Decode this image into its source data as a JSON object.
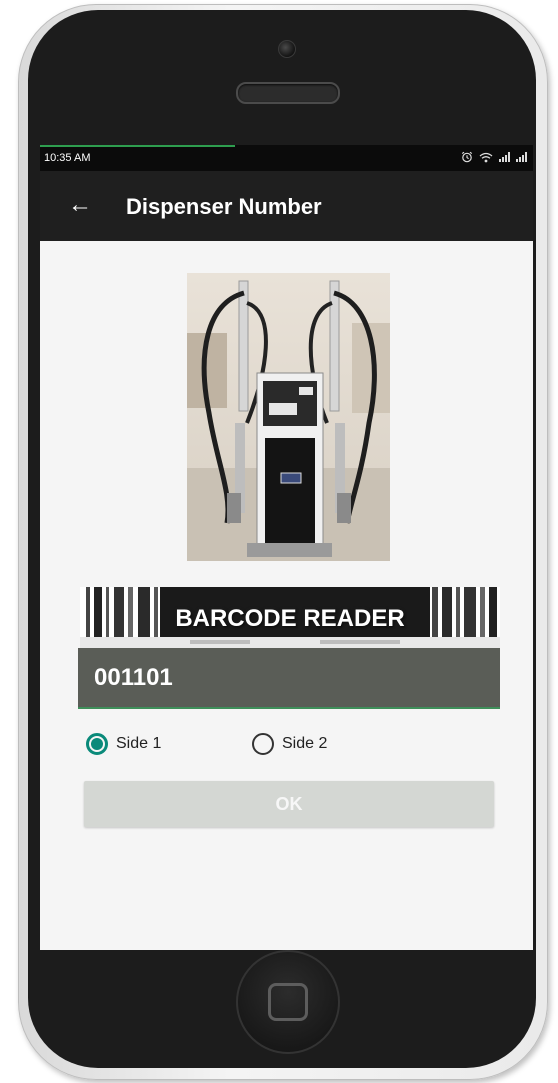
{
  "status_bar": {
    "time": "10:35 AM",
    "icons": [
      "alarm-icon",
      "wifi-icon",
      "signal-icon",
      "signal-icon"
    ],
    "progress_color": "#2e9e4f"
  },
  "app_bar": {
    "back_icon": "←",
    "title": "Dispenser Number"
  },
  "barcode_reader": {
    "label": "BARCODE READER"
  },
  "barcode_field": {
    "value": "001101"
  },
  "side_options": [
    {
      "label": "Side 1",
      "checked": true
    },
    {
      "label": "Side 2",
      "checked": false
    }
  ],
  "ok_button": {
    "label": "OK"
  },
  "colors": {
    "accent": "#0a8a7a",
    "app_bar": "#1f1f1f",
    "input_background": "#5a5d57",
    "button_disabled": "#d4d7d3"
  }
}
